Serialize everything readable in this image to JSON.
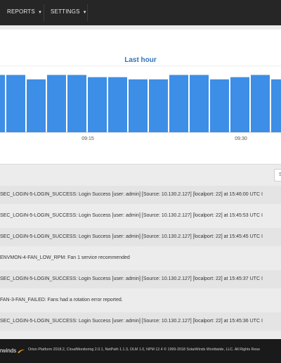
{
  "nav": {
    "items": [
      {
        "label": "REPORTS"
      },
      {
        "label": "SETTINGS"
      }
    ]
  },
  "chart": {
    "title": "Last hour"
  },
  "chart_data": {
    "type": "bar",
    "title": "Last hour",
    "x_tick_labels": [
      "09:15",
      "09:30"
    ],
    "values": [
      26,
      26,
      24,
      26,
      26,
      25,
      25,
      24,
      24,
      26,
      26,
      24,
      25,
      26,
      24
    ],
    "bar_color": "#3d8ee6",
    "grid": true
  },
  "log": {
    "search_text": "S",
    "rows": [
      {
        "text": "SEC_LOGIN-5-LOGIN_SUCCESS: Login Success [user: admin] [Source: 10.130.2.127] [localport: 22] at 15:46:00 UTC I"
      },
      {
        "text": "SEC_LOGIN-5-LOGIN_SUCCESS: Login Success [user: admin] [Source: 10.130.2.127] [localport: 22] at 15:45:53 UTC I"
      },
      {
        "text": "SEC_LOGIN-5-LOGIN_SUCCESS: Login Success [user: admin] [Source: 10.130.2.127] [localport: 22] at 15:45:45 UTC I"
      },
      {
        "text": "ENVMON-4-FAN_LOW_RPM: Fan 1 service recommended"
      },
      {
        "text": "SEC_LOGIN-5-LOGIN_SUCCESS: Login Success [user: admin] [Source: 10.130.2.127] [localport: 22] at 15:45:37 UTC I"
      },
      {
        "text": "FAN-3-FAN_FAILED: Fans had a rotation error reported."
      },
      {
        "text": "SEC_LOGIN-5-LOGIN_SUCCESS: Login Success [user: admin] [Source: 10.130.2.127] [localport: 22] at 15:45:36 UTC I"
      }
    ]
  },
  "footer": {
    "logo_text": "rwinds",
    "text": "Orion Platform 2018.2, CloudMonitoring 2.0.1, NetPath 1.1.3, OLM 1.0, NPM 12.4 © 1999-2018 SolarWinds Worldwide, LLC. All Rights Rese"
  }
}
